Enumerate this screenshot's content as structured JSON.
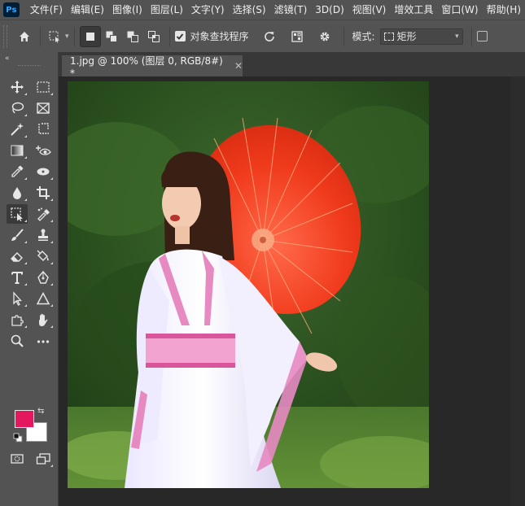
{
  "app": {
    "logo": "Ps"
  },
  "menu": [
    "文件(F)",
    "编辑(E)",
    "图像(I)",
    "图层(L)",
    "文字(Y)",
    "选择(S)",
    "滤镜(T)",
    "3D(D)",
    "视图(V)",
    "增效工具",
    "窗口(W)",
    "帮助(H)"
  ],
  "options": {
    "sample_all_label": "对象查找程序",
    "sample_all_checked": true,
    "mode_label": "模式:",
    "mode_value": "矩形"
  },
  "toolbar": {
    "collapse_label": "«"
  },
  "document": {
    "tab_title": "1.jpg @ 100% (图层 0, RGB/8#) *"
  },
  "colors": {
    "foreground": "#e3185f",
    "background": "#ffffff",
    "accent": "#31a8ff"
  }
}
